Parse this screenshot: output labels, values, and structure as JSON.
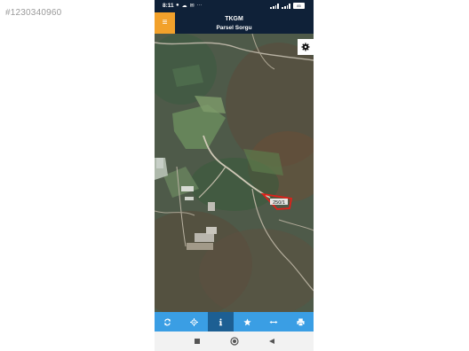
{
  "watermark": {
    "text": "#1230340960"
  },
  "statusbar": {
    "time": "8:11",
    "battery": "85"
  },
  "header": {
    "title": "TKGM",
    "subtitle": "Parsel Sorgu",
    "menu_icon": "hamburger-icon"
  },
  "map": {
    "parcel_label": "250/1",
    "parcel_color": "#e0201a"
  },
  "toolbar": {
    "items": [
      {
        "name": "refresh-icon"
      },
      {
        "name": "locate-icon"
      },
      {
        "name": "info-icon",
        "active": true
      },
      {
        "name": "star-icon"
      },
      {
        "name": "measure-icon"
      },
      {
        "name": "print-icon"
      }
    ]
  },
  "colors": {
    "header": "#0f2138",
    "menu_button": "#f2a12b",
    "toolbar": "#3a9ee4",
    "toolbar_active": "#1d5f93"
  }
}
